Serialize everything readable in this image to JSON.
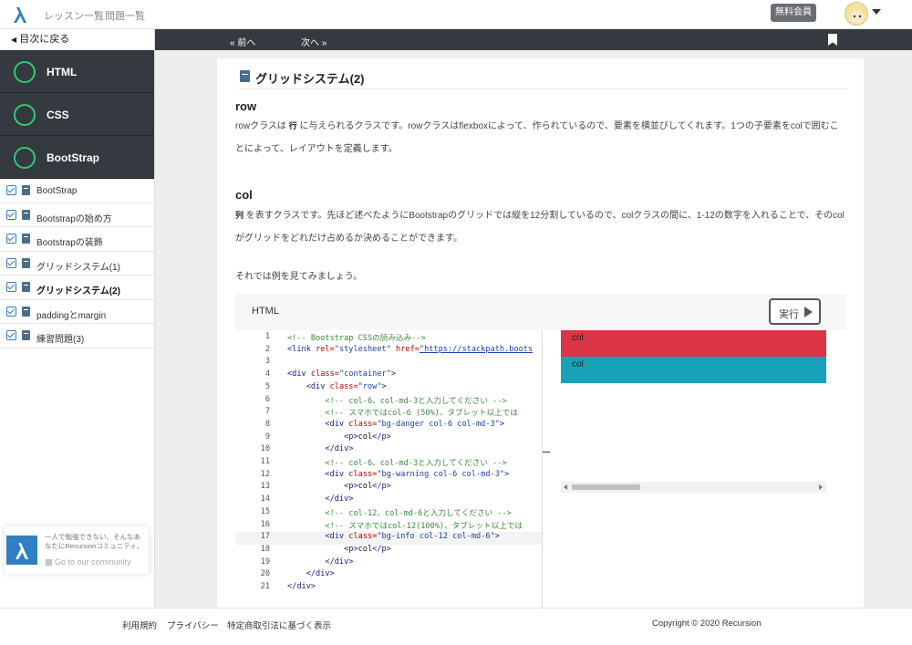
{
  "header": {
    "nav": [
      "レッスン一覧",
      "問題一覧"
    ],
    "member_badge": "無料会員",
    "colors": {
      "logo": "#2f7fc1"
    }
  },
  "sidebar": {
    "back_label": "目次に戻る",
    "sections": [
      {
        "label": "HTML",
        "icon": "progress-ring-icon"
      },
      {
        "label": "CSS",
        "icon": "progress-ring-icon"
      },
      {
        "label": "BootStrap",
        "icon": "progress-ring-icon"
      }
    ],
    "lessons": [
      {
        "label": "BootStrap"
      },
      {
        "label": "Bootstrapの始め方"
      },
      {
        "label": "Bootstrapの装飾"
      },
      {
        "label": "グリッドシステム(1)"
      },
      {
        "label": "グリッドシステム(2)"
      },
      {
        "label": "paddingとmargin"
      },
      {
        "label": "練習問題(3)"
      }
    ],
    "active_lesson": "グリッドシステム(2)",
    "community": {
      "text": "一人で勉強できない、そんなあなたにRecursionコミュニティ。",
      "link": "Go to our community"
    }
  },
  "navstrip": {
    "prev": "前へ",
    "next": "次へ"
  },
  "content": {
    "title": "グリッドシステム(2)",
    "row": {
      "heading": "row",
      "text_pre": "rowクラスは",
      "keyword": "行",
      "text_post": "に与えられるクラスです。rowクラスはflexboxによって、作られているので、要素を横並びしてくれます。1つの子要素をcolで囲むことによって、レイアウトを定義します。"
    },
    "col": {
      "heading": "col",
      "keyword": "列",
      "text_post": "を表すクラスです。先ほど述べたようにBootstrapのグリッドでは縦を12分割しているので、colクラスの間に、1-12の数字を入れることで、そのcolがグリッドをどれだけ占めるか決めることができます。"
    },
    "intro_example": "それでは例を見てみましょう。"
  },
  "code_panel": {
    "label": "HTML",
    "run_label": "実行",
    "lines": [
      {
        "n": "1",
        "html": "<span class='c-com'>&lt;!-- Bootstrap CSSの読み込み--&gt;</span>"
      },
      {
        "n": "2",
        "html": "<span class='c-tag'>&lt;link</span> <span class='c-attr'>rel=</span><span class='c-str'>\"stylesheet\"</span> <span class='c-attr'>href=</span><span class='c-url'>\"https://stackpath.boots</span>"
      },
      {
        "n": "3",
        "html": ""
      },
      {
        "n": "4",
        "html": "<span class='c-tag'>&lt;div</span> <span class='c-attr'>class=</span><span class='c-str'>\"container\"</span><span class='c-tag'>&gt;</span>"
      },
      {
        "n": "5",
        "html": "    <span class='c-tag'>&lt;div</span> <span class='c-attr'>class=</span><span class='c-str'>\"row\"</span><span class='c-tag'>&gt;</span>"
      },
      {
        "n": "6",
        "html": "        <span class='c-com'>&lt;!-- col-6、col-md-3と入力してください --&gt;</span>"
      },
      {
        "n": "7",
        "html": "        <span class='c-com'>&lt;!-- スマホではcol-6 (50%)、タブレット以上では</span>"
      },
      {
        "n": "8",
        "html": "        <span class='c-tag'>&lt;div</span> <span class='c-attr'>class=</span><span class='c-str'>\"bg-danger col-6 col-md-3\"</span><span class='c-tag'>&gt;</span>"
      },
      {
        "n": "9",
        "html": "            <span class='c-tag'>&lt;p&gt;</span>col<span class='c-tag'>&lt;/p&gt;</span>"
      },
      {
        "n": "10",
        "html": "        <span class='c-tag'>&lt;/div&gt;</span>"
      },
      {
        "n": "11",
        "html": "        <span class='c-com'>&lt;!-- col-6、col-md-3と入力してください --&gt;</span>"
      },
      {
        "n": "12",
        "html": "        <span class='c-tag'>&lt;div</span> <span class='c-attr'>class=</span><span class='c-str'>\"bg-warning col-6 col-md-3\"</span><span class='c-tag'>&gt;</span>"
      },
      {
        "n": "13",
        "html": "            <span class='c-tag'>&lt;p&gt;</span>col<span class='c-tag'>&lt;/p&gt;</span>"
      },
      {
        "n": "14",
        "html": "        <span class='c-tag'>&lt;/div&gt;</span>"
      },
      {
        "n": "15",
        "html": "        <span class='c-com'>&lt;!-- col-12、col-md-6と入力してください --&gt;</span>"
      },
      {
        "n": "16",
        "html": "        <span class='c-com'>&lt;!-- スマホではcol-12(100%)、タブレット以上では</span>"
      },
      {
        "n": "17",
        "html": "        <span class='c-tag'>&lt;div</span> <span class='c-attr'>class=</span><span class='c-str'>\"bg-info col-12 col-md-6\"</span><span class='c-tag'>&gt;</span>"
      },
      {
        "n": "18",
        "html": "            <span class='c-tag'>&lt;p&gt;</span>col<span class='c-tag'>&lt;/p&gt;</span>"
      },
      {
        "n": "19",
        "html": "        <span class='c-tag'>&lt;/div&gt;</span>"
      },
      {
        "n": "20",
        "html": "    <span class='c-tag'>&lt;/div&gt;</span>"
      },
      {
        "n": "21",
        "html": "<span class='c-tag'>&lt;/div&gt;</span>"
      }
    ],
    "cursor_line": 17
  },
  "preview": {
    "rows": [
      {
        "label": "col",
        "color": "#dc3545"
      },
      {
        "label": "col",
        "color": "#17a2b8"
      }
    ]
  },
  "footer": {
    "links": [
      "利用規約",
      "プライバシー",
      "特定商取引法に基づく表示"
    ],
    "copyright": "Copyright © 2020 Recursion"
  }
}
